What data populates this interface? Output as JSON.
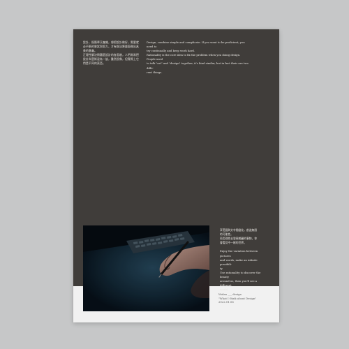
{
  "column1": [
    "設計，既簡單又複雜，想把設計做好，需要就",
    "必不斷的嘗試與努力，才有辦法將畫面做出具",
    "美的意義。",
    "正理性解決問題是設計的各面貌，人們常常把",
    "設計與藝術混為一談，雖然很像，但實際上它",
    "們是不同的東西。"
  ],
  "column2": [
    "Design, combine simple and complicate. If you want to be proficient, you need to",
    "try continually and keep work hard.",
    "Rationality is the core idea to fix the problem when you doing design. People used",
    "to talk \"art\" and \"design\" together, it's kind similar, but in fact their are two diffe-",
    "rent things."
  ],
  "column3": [
    "享受圖與文字間變化，創造無限",
    "的可能性。",
    "再用理性去發現美麗的事物，你",
    "會看見不一樣的世界。",
    "",
    "Enjoy the variation between pictures",
    "and words, make an infinite possibili-",
    "ty.",
    "Use rationality to discover the beauty",
    "around us, then you'll see a different",
    "world."
  ],
  "caption": {
    "line1": "Wulan ___ design",
    "line2": "\"What I think about Design\"",
    "line3": "2022.01.06"
  },
  "photo": {
    "subject": "hand-with-stylus-on-tablet-near-keyboard",
    "colors": {
      "deep": "#060c12",
      "mid": "#1e3a4c",
      "skin": "#b99586"
    }
  },
  "colors": {
    "background": "#c6c7c8",
    "poster_dark": "#403d3a",
    "poster_light": "#f1f1f1",
    "text_light": "#e8e6e2",
    "text_dark": "#5c5c5c"
  }
}
